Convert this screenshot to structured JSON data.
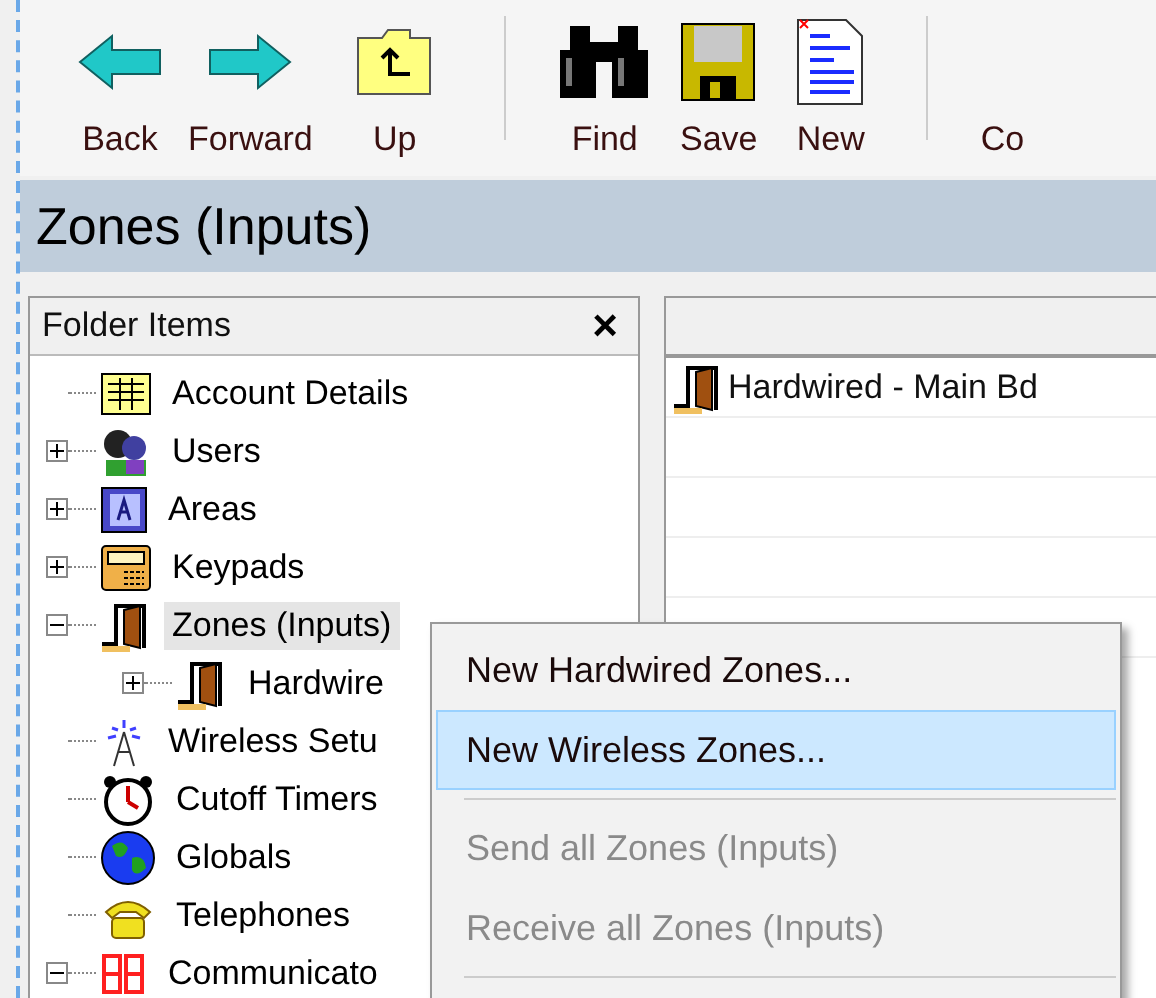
{
  "toolbar": [
    {
      "label": "Back",
      "kind": "back"
    },
    {
      "label": "Forward",
      "kind": "forward"
    },
    {
      "label": "Up",
      "kind": "up"
    },
    {
      "kind": "separator"
    },
    {
      "label": "Find",
      "kind": "find"
    },
    {
      "label": "Save",
      "kind": "save"
    },
    {
      "label": "New",
      "kind": "new"
    },
    {
      "kind": "separator"
    },
    {
      "label": "Co",
      "kind": "cut"
    }
  ],
  "page_title": "Zones (Inputs)",
  "folder_panel": {
    "title": "Folder Items",
    "close": "×",
    "items": [
      {
        "label": "Account Details",
        "kind": "ledger",
        "has_children": false,
        "selected": false
      },
      {
        "label": "Users",
        "kind": "users",
        "has_children": true,
        "expanded": false,
        "selected": false
      },
      {
        "label": "Areas",
        "kind": "areas",
        "has_children": true,
        "expanded": false,
        "selected": false
      },
      {
        "label": "Keypads",
        "kind": "keypad",
        "has_children": true,
        "expanded": false,
        "selected": false
      },
      {
        "label": "Zones (Inputs)",
        "kind": "door",
        "has_children": true,
        "expanded": true,
        "selected": true,
        "children": [
          {
            "label": "Hardwire",
            "kind": "door",
            "has_children": true,
            "expanded": false,
            "selected": false
          }
        ]
      },
      {
        "label": "Wireless Setu",
        "kind": "tower",
        "has_children": false,
        "selected": false
      },
      {
        "label": "Cutoff Timers",
        "kind": "clock",
        "has_children": false,
        "selected": false
      },
      {
        "label": "Globals",
        "kind": "globe",
        "has_children": false,
        "selected": false
      },
      {
        "label": "Telephones",
        "kind": "phone",
        "has_children": false,
        "selected": false
      },
      {
        "label": "Communicato",
        "kind": "digits",
        "has_children": true,
        "expanded": true,
        "selected": false
      }
    ]
  },
  "list_panel": {
    "rows": [
      {
        "label": "Hardwired - Main Bd",
        "kind": "door"
      },
      {},
      {},
      {},
      {}
    ]
  },
  "context_menu": [
    {
      "kind": "item",
      "label": "New Hardwired Zones...",
      "disabled": false,
      "selected": false
    },
    {
      "kind": "item",
      "label": "New Wireless Zones...",
      "disabled": false,
      "selected": true
    },
    {
      "kind": "separator"
    },
    {
      "kind": "item",
      "label": "Send all Zones (Inputs)",
      "disabled": true,
      "selected": false
    },
    {
      "kind": "item",
      "label": "Receive all Zones (Inputs)",
      "disabled": true,
      "selected": false
    },
    {
      "kind": "separator"
    }
  ]
}
